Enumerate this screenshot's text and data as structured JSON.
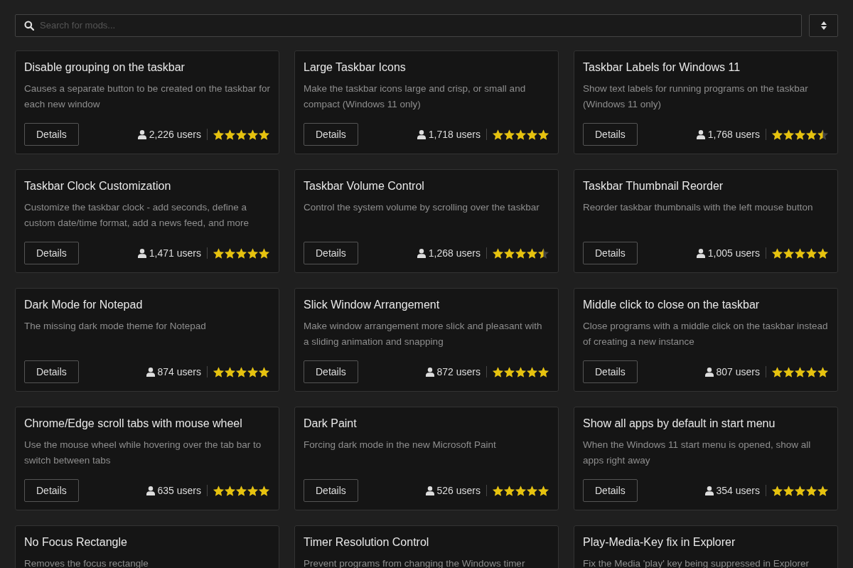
{
  "search": {
    "placeholder": "Search for mods..."
  },
  "mods": [
    {
      "title": "Disable grouping on the taskbar",
      "description": "Causes a separate button to be created on the taskbar for each new window",
      "button": "Details",
      "users": "2,226 users",
      "stars": 5
    },
    {
      "title": "Large Taskbar Icons",
      "description": "Make the taskbar icons large and crisp, or small and compact (Windows 11 only)",
      "button": "Details",
      "users": "1,718 users",
      "stars": 5
    },
    {
      "title": "Taskbar Labels for Windows 11",
      "description": "Show text labels for running programs on the taskbar (Windows 11 only)",
      "button": "Details",
      "users": "1,768 users",
      "stars": 4.5
    },
    {
      "title": "Taskbar Clock Customization",
      "description": "Customize the taskbar clock - add seconds, define a custom date/time format, add a news feed, and more",
      "button": "Details",
      "users": "1,471 users",
      "stars": 5
    },
    {
      "title": "Taskbar Volume Control",
      "description": "Control the system volume by scrolling over the taskbar",
      "button": "Details",
      "users": "1,268 users",
      "stars": 4.5
    },
    {
      "title": "Taskbar Thumbnail Reorder",
      "description": "Reorder taskbar thumbnails with the left mouse button",
      "button": "Details",
      "users": "1,005 users",
      "stars": 5
    },
    {
      "title": "Dark Mode for Notepad",
      "description": "The missing dark mode theme for Notepad",
      "button": "Details",
      "users": "874 users",
      "stars": 5
    },
    {
      "title": "Slick Window Arrangement",
      "description": "Make window arrangement more slick and pleasant with a sliding animation and snapping",
      "button": "Details",
      "users": "872 users",
      "stars": 5
    },
    {
      "title": "Middle click to close on the taskbar",
      "description": "Close programs with a middle click on the taskbar instead of creating a new instance",
      "button": "Details",
      "users": "807 users",
      "stars": 5
    },
    {
      "title": "Chrome/Edge scroll tabs with mouse wheel",
      "description": "Use the mouse wheel while hovering over the tab bar to switch between tabs",
      "button": "Details",
      "users": "635 users",
      "stars": 5
    },
    {
      "title": "Dark Paint",
      "description": "Forcing dark mode in the new Microsoft Paint",
      "button": "Details",
      "users": "526 users",
      "stars": 5
    },
    {
      "title": "Show all apps by default in start menu",
      "description": "When the Windows 11 start menu is opened, show all apps right away",
      "button": "Details",
      "users": "354 users",
      "stars": 5
    },
    {
      "title": "No Focus Rectangle",
      "description": "Removes the focus rectangle"
    },
    {
      "title": "Timer Resolution Control",
      "description": "Prevent programs from changing the Windows timer"
    },
    {
      "title": "Play-Media-Key fix in Explorer",
      "description": "Fix the Media 'play' key being suppressed in Explorer"
    }
  ]
}
